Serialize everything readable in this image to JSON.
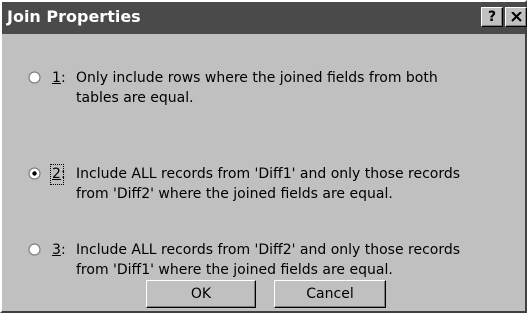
{
  "window": {
    "title": "Join Properties",
    "help_label": "?"
  },
  "options": [
    {
      "number": "1",
      "colon": ":",
      "text": "Only include rows where the joined fields from both\ntables are equal.",
      "selected": false
    },
    {
      "number": "2",
      "colon": ":",
      "text": "Include ALL records from 'Diff1' and only those records\nfrom 'Diff2' where the joined fields are equal.",
      "selected": true
    },
    {
      "number": "3",
      "colon": ":",
      "text": "Include ALL records from 'Diff2' and only those records\nfrom 'Diff1' where the joined fields are equal.",
      "selected": false
    }
  ],
  "buttons": {
    "ok_label": "OK",
    "cancel_label": "Cancel"
  },
  "icons": {
    "help": "help-icon",
    "close": "close-icon",
    "radio": "radio-button"
  }
}
